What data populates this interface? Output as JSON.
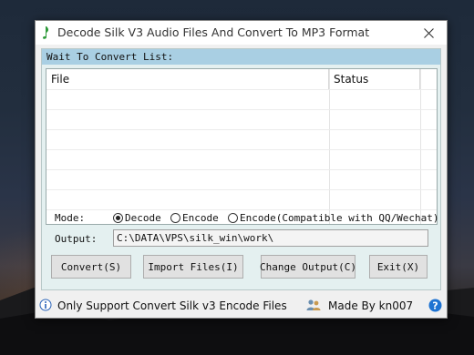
{
  "window": {
    "title": "Decode Silk V3 Audio Files And Convert To MP3 Format",
    "icon": "music-note-icon"
  },
  "list_panel": {
    "header": "Wait To Convert List:",
    "columns": [
      "File",
      "Status"
    ]
  },
  "mode": {
    "label": "Mode:",
    "options": [
      {
        "label": "Decode",
        "selected": true
      },
      {
        "label": "Encode",
        "selected": false
      },
      {
        "label": "Encode(Compatible with QQ/Wechat)",
        "selected": false
      }
    ]
  },
  "output": {
    "label": "Output:",
    "value": "C:\\DATA\\VPS\\silk_win\\work\\"
  },
  "buttons": {
    "convert": "Convert(S)",
    "import": "Import Files(I)",
    "change_output": "Change Output(C)",
    "exit": "Exit(X)"
  },
  "statusbar": {
    "info_text": "Only Support Convert Silk v3 Encode Files",
    "author_text": "Made By kn007"
  },
  "colors": {
    "panel_header": "#a9cfe3",
    "panel_bg": "#e4f0f0",
    "help_blue": "#1e73d2"
  }
}
